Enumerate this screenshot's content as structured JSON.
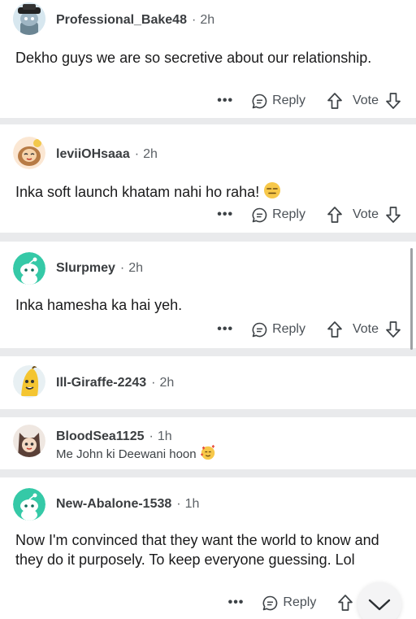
{
  "comments": [
    {
      "username": "Professional_Bake48",
      "time": "2h",
      "text": "Dekho guys we are so secretive about our relationship.",
      "reply_label": "Reply",
      "vote_label": "Vote",
      "more_label": "•••"
    },
    {
      "username": "leviiOHsaaa",
      "time": "2h",
      "text": "Inka soft launch khatam nahi ho raha!",
      "reply_label": "Reply",
      "vote_label": "Vote",
      "more_label": "•••"
    },
    {
      "username": "Slurpmey",
      "time": "2h",
      "text": "Inka hamesha ka hai yeh.",
      "reply_label": "Reply",
      "vote_label": "Vote",
      "more_label": "•••"
    },
    {
      "username": "Ill-Giraffe-2243",
      "time": "2h"
    },
    {
      "username": "BloodSea1125",
      "time": "1h",
      "preview": "Me John ki Deewani hoon"
    },
    {
      "username": "New-Abalone-1538",
      "time": "1h",
      "text": "Now I'm convinced that they want the world to know and they do it purposely. To keep everyone guessing. Lol",
      "reply_label": "Reply",
      "vote_label": "Vo",
      "more_label": "•••"
    }
  ],
  "separator": "·",
  "colors": {
    "background": "#e9eaec",
    "card": "#ffffff",
    "teal_avatar": "#35c9a7",
    "text": "#1a1a1b",
    "meta": "#5c6166"
  },
  "icons": {
    "reply": "comment-bubble-icon",
    "upvote": "arrow-up-icon",
    "downvote": "arrow-down-icon",
    "collapse": "chevron-down-icon"
  }
}
